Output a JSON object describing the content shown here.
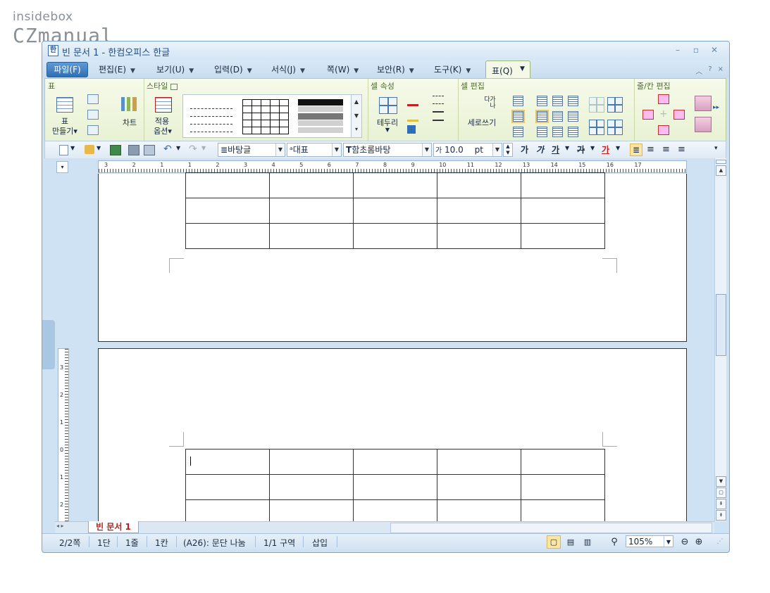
{
  "watermark": {
    "line1": "insidebox",
    "line2": "CZmanual"
  },
  "window": {
    "title": "빈 문서 1 - 한컴오피스 한글",
    "controls": {
      "minimize": "–",
      "restore": "▫",
      "close": "✕"
    }
  },
  "menubar": {
    "file": "파일(F)",
    "items": [
      "편집(E)",
      "보기(U)",
      "입력(D)",
      "서식(J)",
      "쪽(W)",
      "보안(R)",
      "도구(K)"
    ],
    "active_tab": "표(Q)",
    "help": "?",
    "close": "×"
  },
  "ribbon": {
    "groups": [
      {
        "title": "표",
        "buttons": [
          "표\n만들기▾",
          "차트"
        ]
      },
      {
        "title": "스타일",
        "buttons": [
          "적용\n옵션▾"
        ]
      },
      {
        "title": "셀 속성",
        "buttons": [
          "테두리"
        ]
      },
      {
        "title": "셀 편집",
        "buttons": [
          "세로쓰기"
        ]
      },
      {
        "title": "줄/칸 편집",
        "buttons": []
      }
    ],
    "labels": {
      "make_table_1": "표",
      "make_table_2": "만들기",
      "chart": "차트",
      "apply_1": "적용",
      "apply_2": "옵션",
      "border": "테두리",
      "vertical": "세로쓰기",
      "vertical_icon": "가나다"
    }
  },
  "toolbar": {
    "style": "바탕글",
    "language": "대표",
    "font": "함초롬바탕",
    "size": "10.0",
    "size_unit": "pt",
    "size_prefix": "가",
    "bold": "가",
    "italic": "가",
    "underline": "가",
    "strike": "가",
    "color": "가"
  },
  "ruler": {
    "h_numbers": [
      "3",
      "2",
      "1",
      "1",
      "2",
      "3",
      "4",
      "5",
      "6",
      "7",
      "8",
      "9",
      "10",
      "11",
      "12",
      "13",
      "14",
      "15",
      "16",
      "17"
    ],
    "v_numbers": [
      "3",
      "2",
      "1",
      "0",
      "1",
      "2"
    ]
  },
  "document": {
    "table_rows_page1": 3,
    "table_rows_page2": 3,
    "table_cols": 5
  },
  "tabs": {
    "doc_tab": "빈 문서 1"
  },
  "status": {
    "page": "2/2쪽",
    "column": "1단",
    "line": "1줄",
    "cell": "1칸",
    "para": "(A26): 문단 나눔",
    "section": "1/1 구역",
    "mode": "삽입",
    "zoom": "105%"
  },
  "colors": {
    "accent": "#2f6fb3",
    "ribbon": "#e8f2d4",
    "frame": "#cfe2f3"
  },
  "icons": [
    "search-icon",
    "zoom-out-icon",
    "zoom-in-icon",
    "new-doc-icon",
    "open-folder-icon",
    "save-icon",
    "print-icon",
    "undo-icon",
    "redo-icon"
  ]
}
